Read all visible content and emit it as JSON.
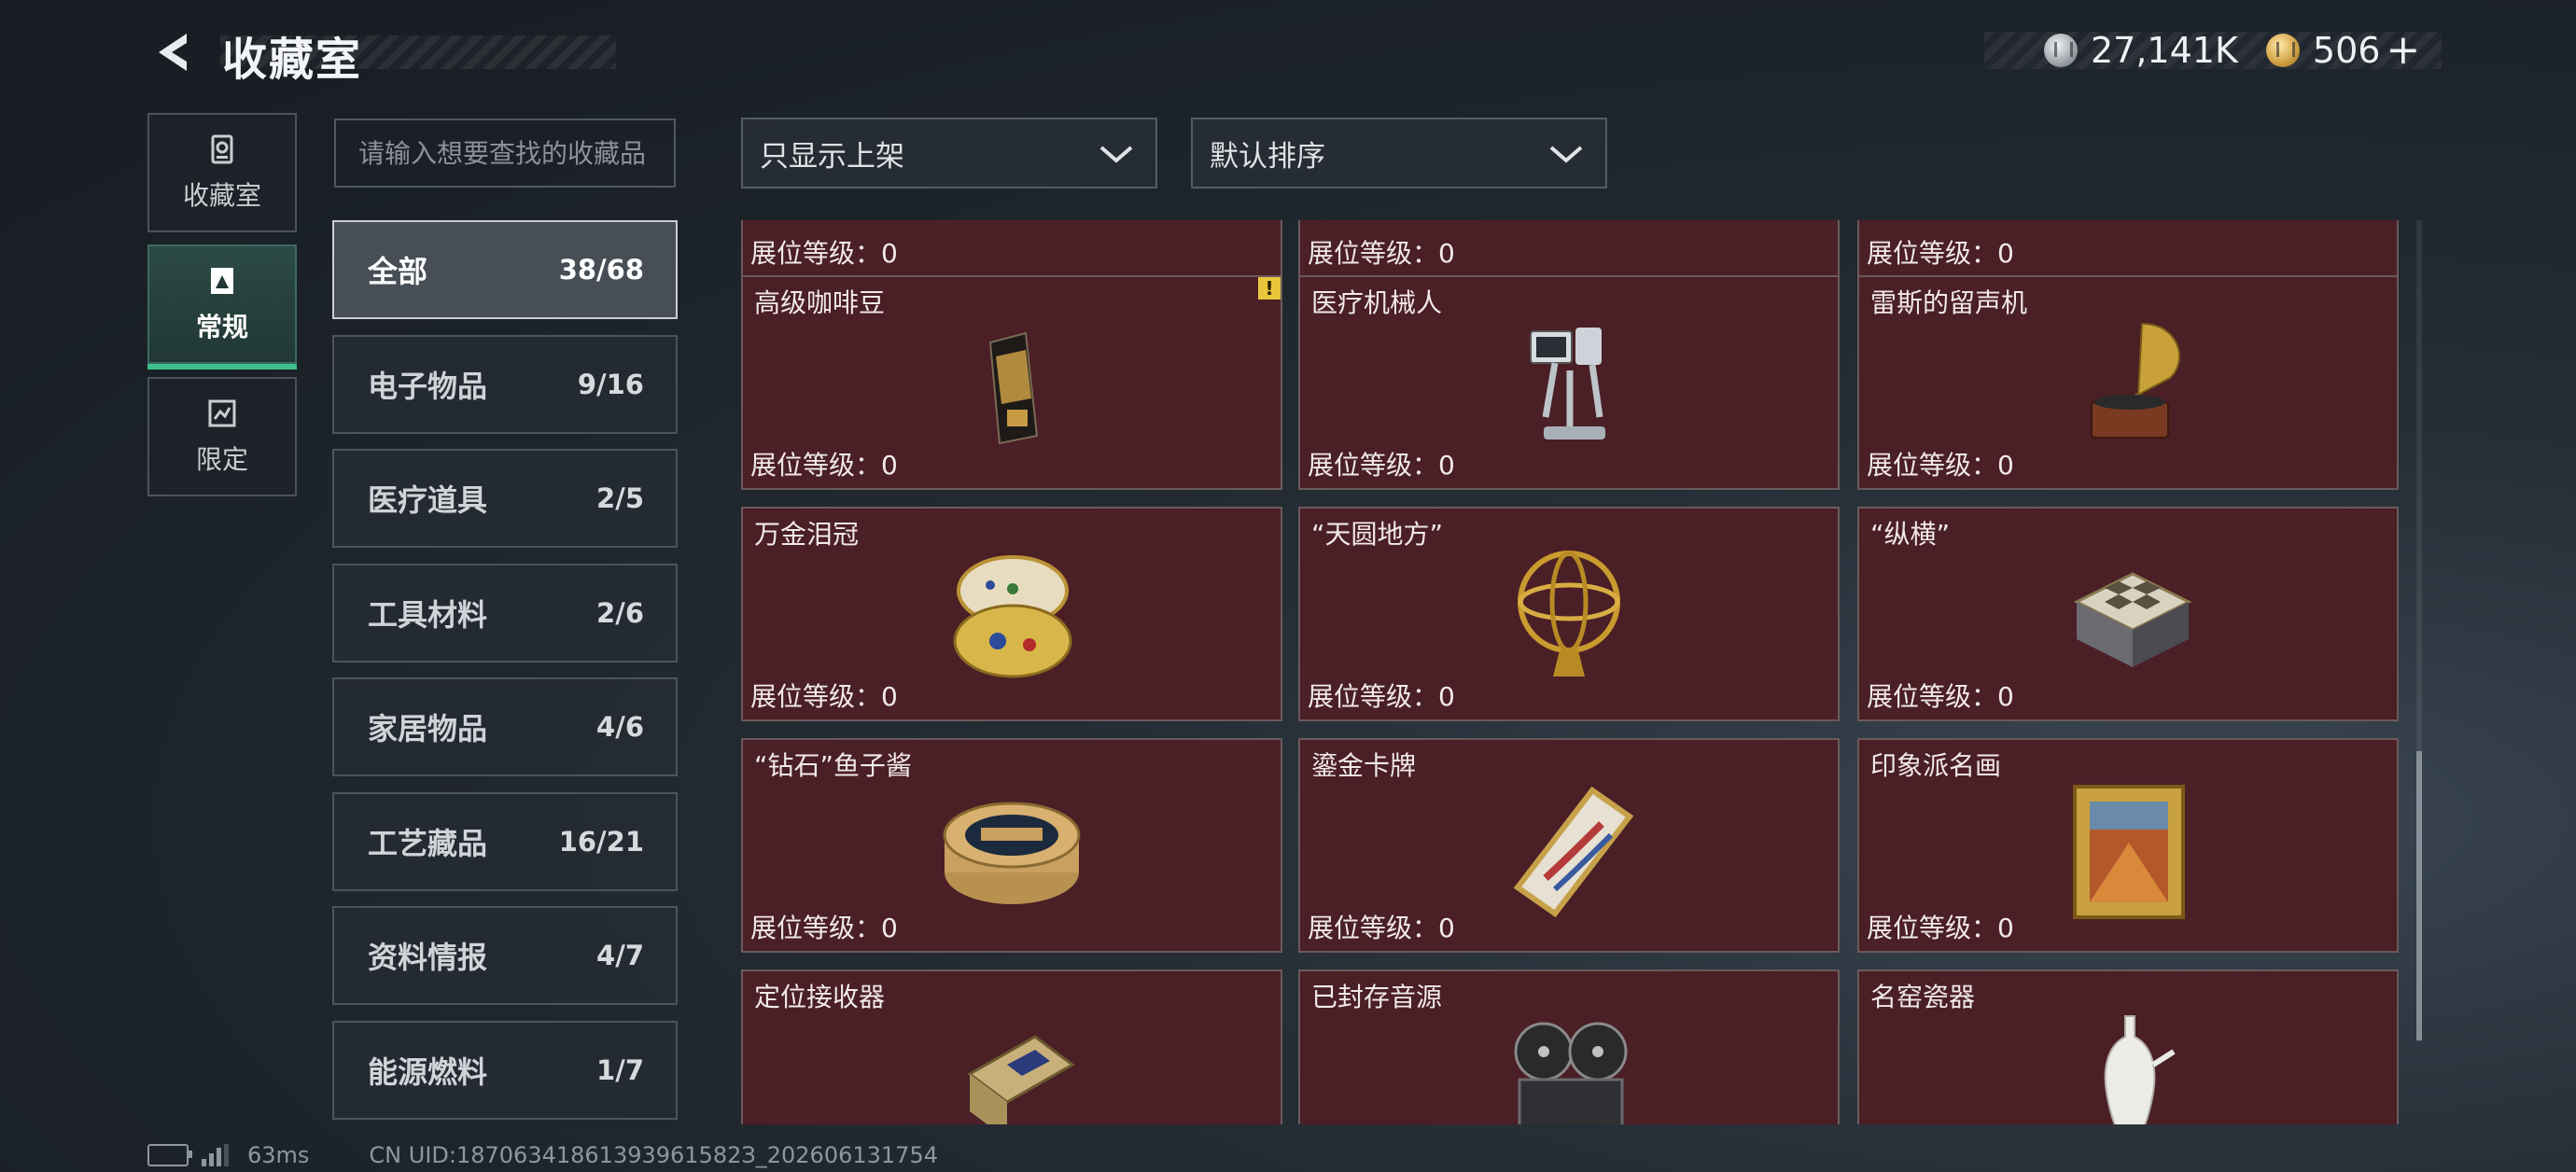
{
  "header": {
    "title": "收藏室",
    "currency_silver": "27,141K",
    "currency_gold": "506",
    "plus": "+"
  },
  "nav": [
    {
      "label": "收藏室",
      "icon": "collection-room-icon"
    },
    {
      "label": "常规",
      "icon": "regular-icon"
    },
    {
      "label": "限定",
      "icon": "limited-icon"
    }
  ],
  "search": {
    "placeholder": "请输入想要查找的收藏品"
  },
  "filters": {
    "shelf": "只显示上架",
    "sort": "默认排序"
  },
  "categories": [
    {
      "name": "全部",
      "count": "38/68"
    },
    {
      "name": "电子物品",
      "count": "9/16"
    },
    {
      "name": "医疗道具",
      "count": "2/5"
    },
    {
      "name": "工具材料",
      "count": "2/6"
    },
    {
      "name": "家居物品",
      "count": "4/6"
    },
    {
      "name": "工艺藏品",
      "count": "16/21"
    },
    {
      "name": "资料情报",
      "count": "4/7"
    },
    {
      "name": "能源燃料",
      "count": "1/7"
    }
  ],
  "level_label": "展位等级：0",
  "items": [
    {
      "name": "",
      "art": "partial-item-icon"
    },
    {
      "name": "",
      "art": "partial-item-icon"
    },
    {
      "name": "",
      "art": "partial-item-icon"
    },
    {
      "name": "高级咖啡豆",
      "art": "coffee-bag-icon",
      "warning": "!"
    },
    {
      "name": "医疗机械人",
      "art": "medical-robot-icon"
    },
    {
      "name": "雷斯的留声机",
      "art": "gramophone-icon"
    },
    {
      "name": "万金泪冠",
      "art": "jeweled-egg-icon"
    },
    {
      "name": "“天圆地方”",
      "art": "armillary-sphere-icon"
    },
    {
      "name": "“纵横”",
      "art": "chess-box-icon"
    },
    {
      "name": "“钻石”鱼子酱",
      "art": "caviar-tin-icon"
    },
    {
      "name": "鎏金卡牌",
      "art": "gilded-card-icon"
    },
    {
      "name": "印象派名画",
      "art": "framed-painting-icon"
    },
    {
      "name": "定位接收器",
      "art": "gps-receiver-icon"
    },
    {
      "name": "已封存音源",
      "art": "reel-tape-icon"
    },
    {
      "name": "名窑瓷器",
      "art": "porcelain-vase-icon"
    }
  ],
  "footer": {
    "ping": "63ms",
    "uid": "CN UID:18706341861393961582З_202606131754"
  }
}
